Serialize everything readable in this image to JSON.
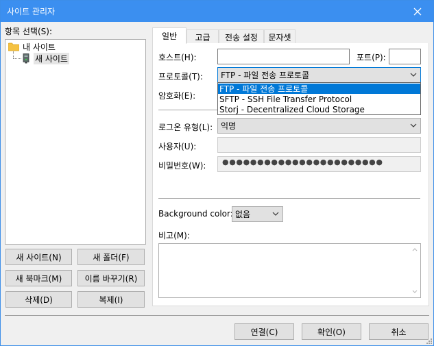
{
  "window": {
    "title": "사이트 관리자"
  },
  "tree": {
    "header": "항목 선택(S):",
    "root_label": "내 사이트",
    "child_label": "새 사이트"
  },
  "left_buttons": {
    "new_site": "새 사이트(N)",
    "new_folder": "새 폴더(F)",
    "new_bookmark": "새 북마크(M)",
    "rename": "이름 바꾸기(R)",
    "delete": "삭제(D)",
    "duplicate": "복제(I)"
  },
  "tabs": [
    {
      "label": "일반",
      "active": true
    },
    {
      "label": "고급"
    },
    {
      "label": "전송 설정"
    },
    {
      "label": "문자셋"
    }
  ],
  "general": {
    "host_label": "호스트(H):",
    "host_value": "",
    "port_label": "포트(P):",
    "port_value": "",
    "protocol_label": "프로토콜(T):",
    "protocol_value": "FTP - 파일 전송 프로토콜",
    "encryption_label": "암호화(E):",
    "logon_type_label": "로그온 유형(L):",
    "logon_type_value": "익명",
    "user_label": "사용자(U):",
    "user_value": "",
    "password_label": "비밀번호(W):",
    "password_mask": "●●●●●●●●●●●●●●●●●●●●●●●",
    "bg_color_label": "Background color:",
    "bg_color_value": "없음",
    "notes_label": "비고(M):"
  },
  "protocol_options": [
    "FTP - 파일 전송 프로토콜",
    "SFTP - SSH File Transfer Protocol",
    "Storj - Decentralized Cloud Storage"
  ],
  "footer": {
    "connect": "연결(C)",
    "ok": "확인(O)",
    "cancel": "취소"
  },
  "colors": {
    "titlebar": "#3b8ff0",
    "selection": "#0078d7",
    "folder": "#f5c242"
  },
  "icons": {
    "close": "close-icon",
    "folder": "folder-icon",
    "site": "server-icon",
    "chevron": "chevron-down-icon"
  }
}
